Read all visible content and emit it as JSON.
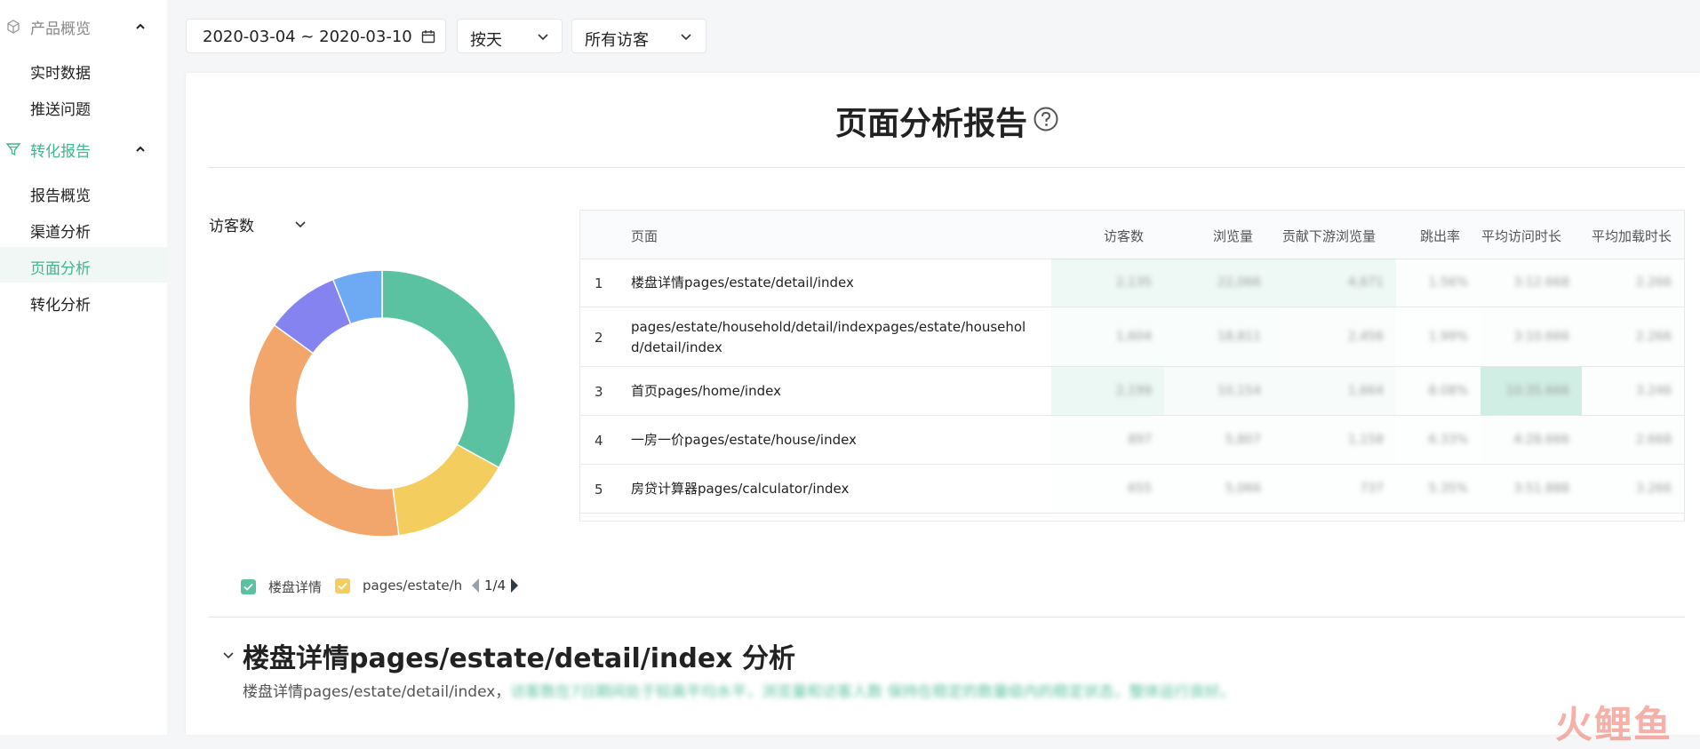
{
  "sidebar": {
    "groups": [
      {
        "label": "产品概览",
        "icon": "cube-icon",
        "color": "#888888",
        "items": [
          "实时数据",
          "推送问题"
        ]
      },
      {
        "label": "转化报告",
        "icon": "funnel-icon",
        "color": "#3fb68b",
        "items": [
          "报告概览",
          "渠道分析",
          "页面分析",
          "转化分析"
        ]
      }
    ],
    "active_item": "页面分析"
  },
  "toolbar": {
    "date_range": "2020-03-04 ~ 2020-03-10",
    "granularity": "按天",
    "visitor_filter": "所有访客"
  },
  "report": {
    "title": "页面分析报告",
    "metric_select": "访客数"
  },
  "chart_data": {
    "type": "pie",
    "donut": true,
    "slices": [
      {
        "label": "楼盘详情",
        "value": 33,
        "color": "#5bc2a1"
      },
      {
        "label": "pages/estate/h",
        "value": 15,
        "color": "#f3cd5e"
      },
      {
        "label": "",
        "value": 37,
        "color": "#f2a66b"
      },
      {
        "label": "",
        "value": 9,
        "color": "#8483ef"
      },
      {
        "label": "",
        "value": 6,
        "color": "#6ea9f3"
      }
    ],
    "legend": {
      "items": [
        "楼盘详情",
        "pages/estate/h"
      ],
      "page": "1/4",
      "placement": "bottom"
    }
  },
  "table": {
    "headers": [
      "页面",
      "访客数",
      "浏览量",
      "贡献下游浏览量",
      "跳出率",
      "平均访问时长",
      "平均加载时长"
    ],
    "rows": [
      {
        "index": "1",
        "page": "楼盘详情pages/estate/detail/index",
        "values": [
          "2,135",
          "22,066",
          "4,671",
          "1.56%",
          "3:12.668",
          "2.266"
        ]
      },
      {
        "index": "2",
        "page": "pages/estate/household/detail/indexpages/estate/household/detail/index",
        "values": [
          "1,604",
          "18,811",
          "2,456",
          "1.99%",
          "3:10.666",
          "2.266"
        ]
      },
      {
        "index": "3",
        "page": "首页pages/home/index",
        "values": [
          "2,199",
          "10,154",
          "1,664",
          "8.08%",
          "10:35.666",
          "3.246"
        ]
      },
      {
        "index": "4",
        "page": "一房一价pages/estate/house/index",
        "values": [
          "897",
          "5,807",
          "1,158",
          "6.33%",
          "4:28.666",
          "2.668"
        ]
      },
      {
        "index": "5",
        "page": "房贷计算器pages/calculator/index",
        "values": [
          "655",
          "5,066",
          "737",
          "5.35%",
          "3:51.888",
          "3.266"
        ]
      }
    ]
  },
  "section": {
    "title": "楼盘详情pages/estate/detail/index 分析",
    "desc_prefix": "楼盘详情pages/estate/detail/index，",
    "desc_blurred": "访客数在7日期间处于较高平均水平，浏览量和访客人数 保持在稳定的数量级内的稳定状态，整体运行良好。"
  },
  "watermark": "火鲤鱼"
}
